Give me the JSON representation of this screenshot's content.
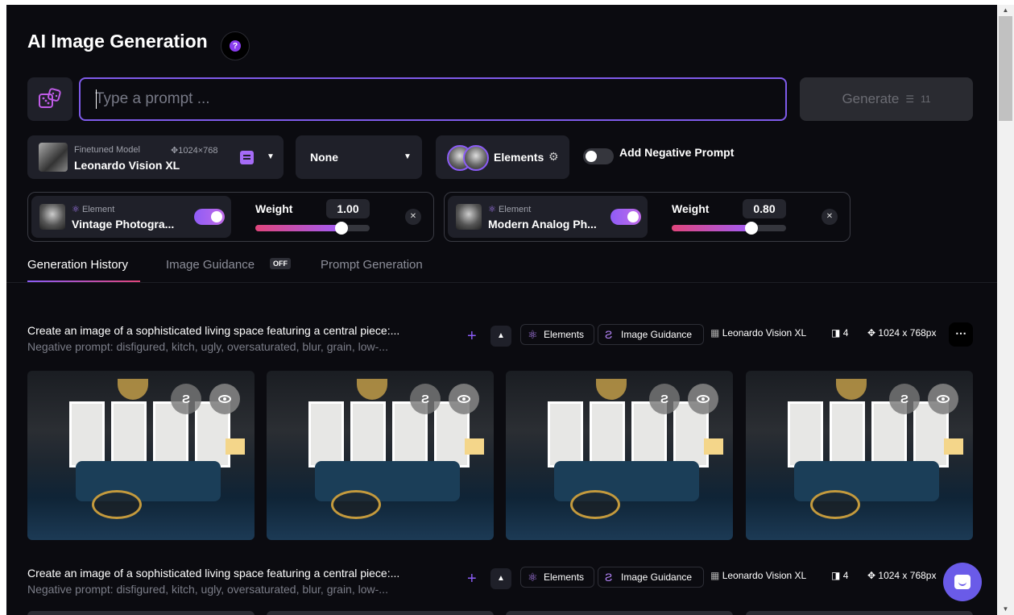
{
  "header": {
    "title": "AI Image Generation",
    "help_icon": "question-icon"
  },
  "prompt": {
    "placeholder": "Type a prompt ...",
    "value": ""
  },
  "generate": {
    "label": "Generate",
    "token_cost": "11"
  },
  "model": {
    "type_label": "Finetuned Model",
    "dimensions": "1024×768",
    "name": "Leonardo Vision XL"
  },
  "style_select": {
    "value": "None"
  },
  "elements_button": {
    "label": "Elements"
  },
  "negative_prompt": {
    "label": "Add Negative Prompt",
    "enabled": false
  },
  "elements": [
    {
      "tag": "Element",
      "name": "Vintage Photogra...",
      "enabled": true,
      "weight_label": "Weight",
      "weight": "1.00",
      "weight_fraction": 0.75
    },
    {
      "tag": "Element",
      "name": "Modern Analog Ph...",
      "enabled": true,
      "weight_label": "Weight",
      "weight": "0.80",
      "weight_fraction": 0.7
    }
  ],
  "tabs": [
    {
      "label": "Generation History",
      "active": true
    },
    {
      "label": "Image Guidance",
      "badge": "OFF"
    },
    {
      "label": "Prompt Generation"
    }
  ],
  "generations": [
    {
      "prompt": "Create an image of a sophisticated living space featuring a central piece:...",
      "negative": "Negative prompt: disfigured, kitch, ugly, oversaturated, blur, grain, low-...",
      "chips": [
        "Elements",
        "Image Guidance"
      ],
      "model": "Leonardo Vision XL",
      "count": "4",
      "size": "1024 x 768px"
    },
    {
      "prompt": "Create an image of a sophisticated living space featuring a central piece:...",
      "negative": "Negative prompt: disfigured, kitch, ugly, oversaturated, blur, grain, low-...",
      "chips": [
        "Elements",
        "Image Guidance"
      ],
      "model": "Leonardo Vision XL",
      "count": "4",
      "size": "1024 x 768px"
    }
  ],
  "colors": {
    "accent": "#8b5cf6",
    "background": "#0b0b10",
    "panel": "#1f2029"
  }
}
